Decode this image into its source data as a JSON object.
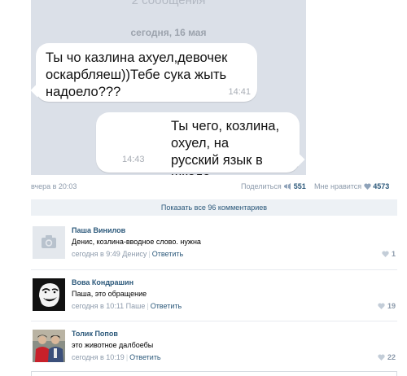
{
  "chat": {
    "message_count": "2 сообщения",
    "date": "сегодня, 16 мая",
    "messages": [
      {
        "text": "Ты чо казлина ахуел,девочек оскарбляеш))Тебе сука жыть надоело???",
        "time": "14:41"
      },
      {
        "text": "Ты чего, козлина, охуел, на\nрусский язык в школе\nзабивать?",
        "time": "14:43"
      }
    ]
  },
  "post": {
    "time": "вчера в 20:03",
    "share_label": "Поделиться",
    "share_count": "551",
    "like_label": "Мне нравится",
    "like_count": "4573"
  },
  "show_all": "Показать все 96 комментариев",
  "comments": [
    {
      "author": "Паша Винилов",
      "text": "Денис, козлина-вводное слово. нужна",
      "meta": "сегодня в 9:49 Денису",
      "reply": "Ответить",
      "likes": "1",
      "avatar": "camera-placeholder"
    },
    {
      "author": "Вова Кондрашин",
      "text": "Паша, это обращение",
      "meta": "сегодня в 10:11 Паше",
      "reply": "Ответить",
      "likes": "19",
      "avatar": "meme-face"
    },
    {
      "author": "Толик Попов",
      "text": "это животное далбоебы",
      "meta": "сегодня в 10:19",
      "reply": "Ответить",
      "likes": "22",
      "avatar": "two-people-photo"
    }
  ],
  "colors": {
    "link": "#2b587a",
    "muted": "#8c9aab",
    "chat_bg": "#dbe0e8",
    "bar_bg": "#edf1f5"
  }
}
